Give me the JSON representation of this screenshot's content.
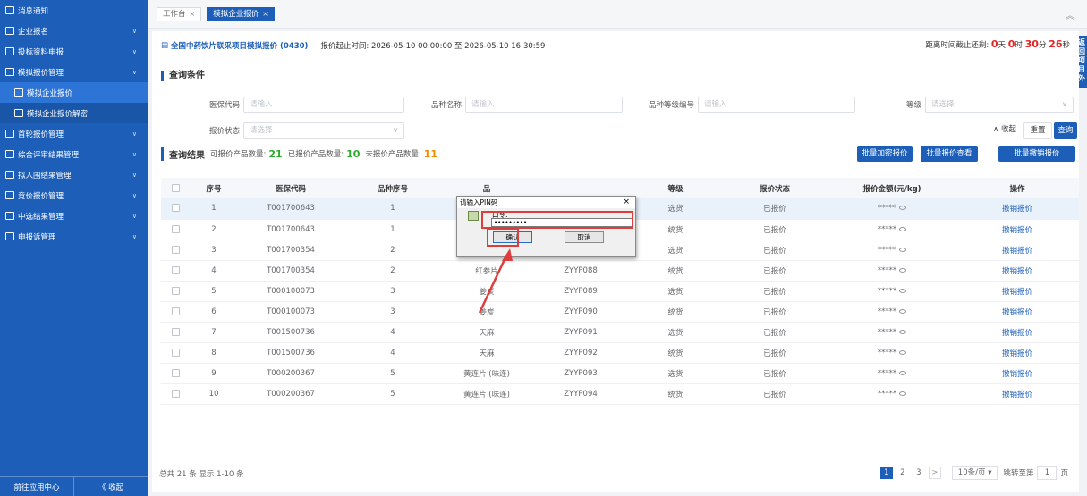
{
  "sidebar": {
    "items": [
      {
        "label": "消息通知",
        "chevron": false
      },
      {
        "label": "企业报名",
        "chevron": true
      },
      {
        "label": "投标资料申报",
        "chevron": true
      },
      {
        "label": "模拟报价管理",
        "chevron": true
      }
    ],
    "subitems": [
      {
        "label": "模拟企业报价",
        "active": true
      },
      {
        "label": "模拟企业报价解密",
        "active": false
      }
    ],
    "items_after": [
      {
        "label": "首轮报价管理"
      },
      {
        "label": "综合评审结果管理"
      },
      {
        "label": "拟入围结果管理"
      },
      {
        "label": "竞价报价管理"
      },
      {
        "label": "中选结果管理"
      },
      {
        "label": "申报诉管理"
      }
    ],
    "footer": {
      "app_center": "前往应用中心",
      "collapse": "《 收起"
    }
  },
  "tabs": [
    {
      "label": "工作台",
      "active": false
    },
    {
      "label": "模拟企业报价",
      "active": true
    }
  ],
  "header": {
    "project_name": "全国中药饮片联采项目模拟报价 (0430)",
    "time_label": "报价起止时间: 2026-05-10 00:00:00 至 2026-05-10 16:30:59",
    "countdown_prefix": "距离时间截止还剩:",
    "days": "0",
    "days_unit": "天",
    "hours": "0",
    "hours_unit": "时",
    "minutes": "30",
    "minutes_unit": "分",
    "seconds": "26",
    "seconds_unit": "秒"
  },
  "ribbon": "返回项目外",
  "query": {
    "title": "查询条件",
    "fields": {
      "insurance_code": {
        "label": "医保代码",
        "placeholder": "请输入"
      },
      "product_name": {
        "label": "品种名称",
        "placeholder": "请输入"
      },
      "grade_code": {
        "label": "品种等级编号",
        "placeholder": "请输入"
      },
      "grade": {
        "label": "等级",
        "placeholder": "请选择"
      },
      "status": {
        "label": "报价状态",
        "placeholder": "请选择"
      }
    },
    "buttons": {
      "collapse": "∧ 收起",
      "reset": "重置",
      "search": "查询"
    }
  },
  "results": {
    "title": "查询结果",
    "quotable_label": "可报价产品数量:",
    "quotable": "21",
    "quoted_label": "已报价产品数量:",
    "quoted": "10",
    "unquoted_label": "未报价产品数量:",
    "unquoted": "11",
    "buttons": {
      "batch_encrypt": "批量加密报价",
      "batch_view": "批量报价查看",
      "batch_revoke": "批量撤销报价"
    }
  },
  "table": {
    "headers": [
      "",
      "序号",
      "医保代码",
      "品种序号",
      "品",
      "",
      "等级",
      "报价状态",
      "报价金额(元/kg)",
      "操作"
    ],
    "rows": [
      [
        "1",
        "T001700643",
        "1",
        "",
        "",
        "选货",
        "已报价",
        "*****",
        "撤销报价"
      ],
      [
        "2",
        "T001700643",
        "1",
        "",
        "",
        "统货",
        "已报价",
        "*****",
        "撤销报价"
      ],
      [
        "3",
        "T001700354",
        "2",
        "",
        "",
        "选货",
        "已报价",
        "*****",
        "撤销报价"
      ],
      [
        "4",
        "T001700354",
        "2",
        "红参片",
        "ZYYP088",
        "统货",
        "已报价",
        "*****",
        "撤销报价"
      ],
      [
        "5",
        "T000100073",
        "3",
        "姜炭",
        "ZYYP089",
        "选货",
        "已报价",
        "*****",
        "撤销报价"
      ],
      [
        "6",
        "T000100073",
        "3",
        "姜炭",
        "ZYYP090",
        "统货",
        "已报价",
        "*****",
        "撤销报价"
      ],
      [
        "7",
        "T001500736",
        "4",
        "天麻",
        "ZYYP091",
        "选货",
        "已报价",
        "*****",
        "撤销报价"
      ],
      [
        "8",
        "T001500736",
        "4",
        "天麻",
        "ZYYP092",
        "统货",
        "已报价",
        "*****",
        "撤销报价"
      ],
      [
        "9",
        "T000200367",
        "5",
        "黄连片 (味连)",
        "ZYYP093",
        "选货",
        "已报价",
        "*****",
        "撤销报价"
      ],
      [
        "10",
        "T000200367",
        "5",
        "黄连片 (味连)",
        "ZYYP094",
        "统货",
        "已报价",
        "*****",
        "撤销报价"
      ]
    ]
  },
  "pager": {
    "summary": "总共 21 条 显示 1-10 条",
    "pages": [
      "1",
      "2",
      "3"
    ],
    "current": "1",
    "next": ">",
    "page_size": "10条/页",
    "jump_prefix": "跳转至第",
    "jump_value": "1",
    "jump_suffix": "页"
  },
  "pin_dialog": {
    "title": "请输入PIN码",
    "close": "×",
    "label": "口令:",
    "value": "•••••••••",
    "ok": "确认",
    "cancel": "取消"
  },
  "colors": {
    "brand": "#1d5fb8",
    "annotation": "#e03c3c",
    "green": "#2eaa2e",
    "orange": "#f08c00"
  }
}
